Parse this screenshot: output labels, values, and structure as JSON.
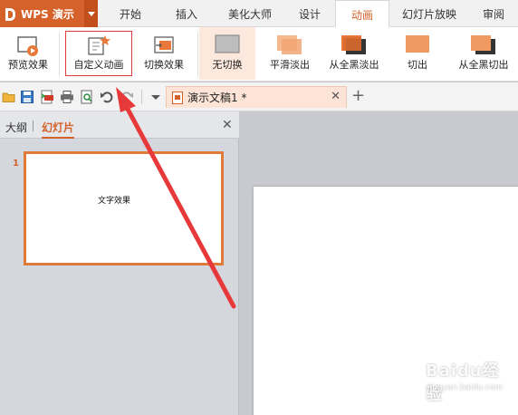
{
  "app": {
    "name": "WPS 演示",
    "brand_color": "#d5612b"
  },
  "menu": {
    "tabs": [
      {
        "label": "开始"
      },
      {
        "label": "插入"
      },
      {
        "label": "美化大师"
      },
      {
        "label": "设计"
      },
      {
        "label": "动画",
        "active": true
      },
      {
        "label": "幻灯片放映"
      },
      {
        "label": "审阅"
      }
    ]
  },
  "ribbon": {
    "buttons": [
      {
        "label": "预览效果",
        "icon": "preview-play-icon"
      },
      {
        "label": "自定义动画",
        "icon": "custom-animation-star-icon",
        "highlighted": true
      },
      {
        "label": "切换效果",
        "icon": "transition-effect-icon"
      },
      {
        "label": "无切换",
        "icon": "no-transition-icon",
        "selected": true
      },
      {
        "label": "平滑淡出",
        "icon": "fade-smooth-icon"
      },
      {
        "label": "从全黑淡出",
        "icon": "fade-through-black-icon"
      },
      {
        "label": "切出",
        "icon": "cut-icon"
      },
      {
        "label": "从全黑切出",
        "icon": "cut-through-black-icon"
      }
    ]
  },
  "quickbar": {
    "icons": [
      "open-folder-icon",
      "save-icon",
      "export-pdf-icon",
      "print-icon",
      "print-preview-icon",
      "undo-icon",
      "redo-icon",
      "dropdown-icon"
    ],
    "document_tab": {
      "title": "演示文稿1 *"
    }
  },
  "left_panel": {
    "tab_outline": "大纲",
    "tab_slides": "幻灯片",
    "slides": [
      {
        "number": "1",
        "text": "文字效果"
      }
    ]
  },
  "watermark": {
    "brand": "Baidu经验",
    "url": "jingyan.baidu.com"
  },
  "colors": {
    "accent": "#d5612b",
    "annotation": "#e8393a",
    "highlight_border": "#e03a3a"
  }
}
